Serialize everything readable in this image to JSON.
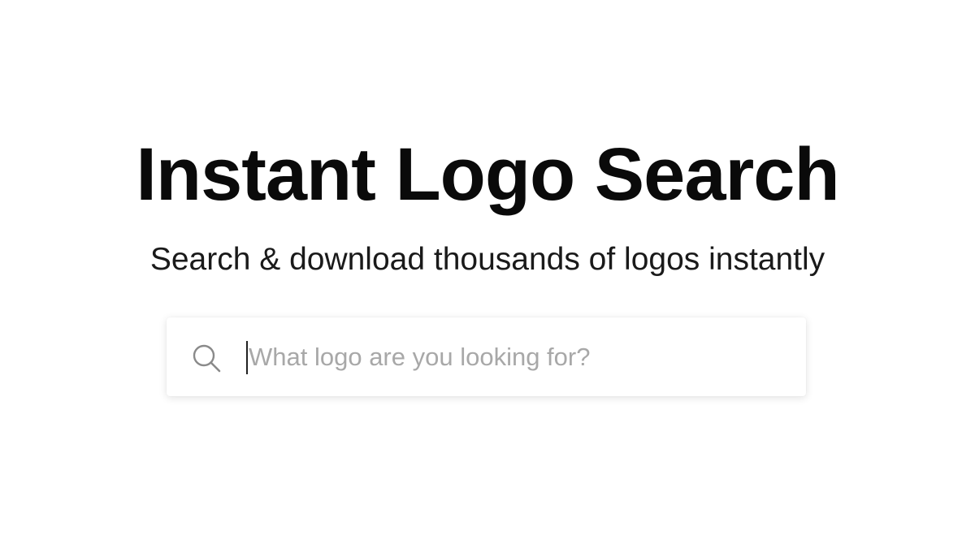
{
  "hero": {
    "title": "Instant Logo Search",
    "subtitle": "Search & download thousands of logos instantly"
  },
  "search": {
    "placeholder": "What logo are you looking for?",
    "value": "",
    "icon": "search-icon"
  },
  "colors": {
    "background": "#ffffff",
    "title": "#0a0a0a",
    "subtitle": "#1a1a1a",
    "placeholder": "#a8a8a8"
  }
}
